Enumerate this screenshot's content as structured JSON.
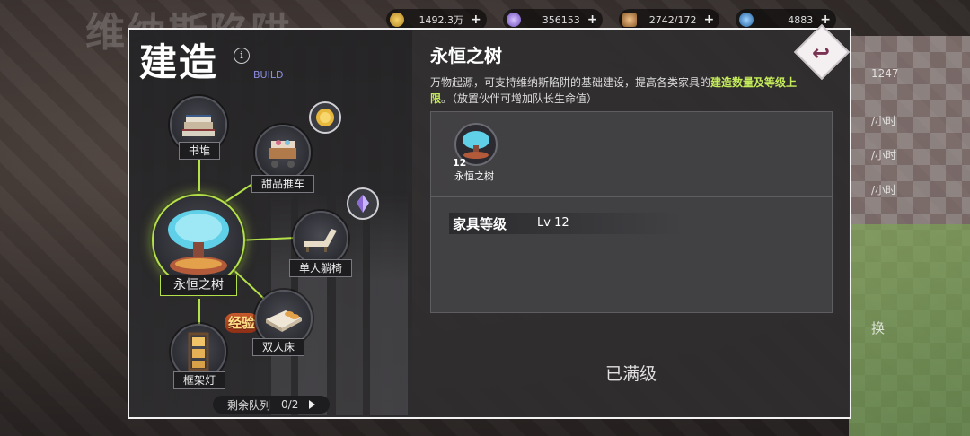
{
  "background": {
    "title": "维纳斯陷阱",
    "right_texts": [
      "1247",
      "/小时",
      "/小时",
      "/小时",
      "换"
    ]
  },
  "resources": [
    {
      "value": "1492.3万",
      "plus": "+",
      "color": "#e2b53b"
    },
    {
      "value": "356153",
      "plus": "+",
      "color": "#9d7adf"
    },
    {
      "value": "2742/172",
      "plus": "+",
      "color": "#c99252"
    },
    {
      "value": "4883",
      "plus": "+",
      "color": "#3d8fd6"
    }
  ],
  "build_panel": {
    "title": "建造",
    "info_icon": "i",
    "subtitle": "BUILD",
    "nodes": [
      {
        "label": "书堆",
        "icon": "book-pile-icon"
      },
      {
        "label": "甜品推车",
        "icon": "dessert-cart-icon"
      },
      {
        "label": "永恒之树",
        "icon": "eternal-tree-icon",
        "active": true
      },
      {
        "label": "单人躺椅",
        "icon": "lounge-chair-icon"
      },
      {
        "label": "双人床",
        "icon": "double-bed-icon"
      },
      {
        "label": "框架灯",
        "icon": "frame-lamp-icon"
      }
    ],
    "bubbles": [
      "gold-coin-icon",
      "crystal-icon"
    ],
    "exp_badge": "经验",
    "queue": {
      "label": "剩余队列",
      "value": "0/2"
    }
  },
  "detail": {
    "title": "永恒之树",
    "desc_part1": "万物起源，可支持维纳斯陷阱的基础建设，提高各类家具的",
    "desc_highlight": "建造数量及等级上限",
    "desc_part2": "。（放置伙伴可增加队长生命值）",
    "item": {
      "level": "12",
      "name": "永恒之树"
    },
    "attr_key": "家具等级",
    "attr_value": "Lv 12",
    "status": "已满级"
  },
  "back_icon": "back-arrow-icon",
  "colors": {
    "accent_green": "#b4e04a",
    "highlight_text": "#c4ec5a",
    "frame": "#f2f2f2"
  }
}
